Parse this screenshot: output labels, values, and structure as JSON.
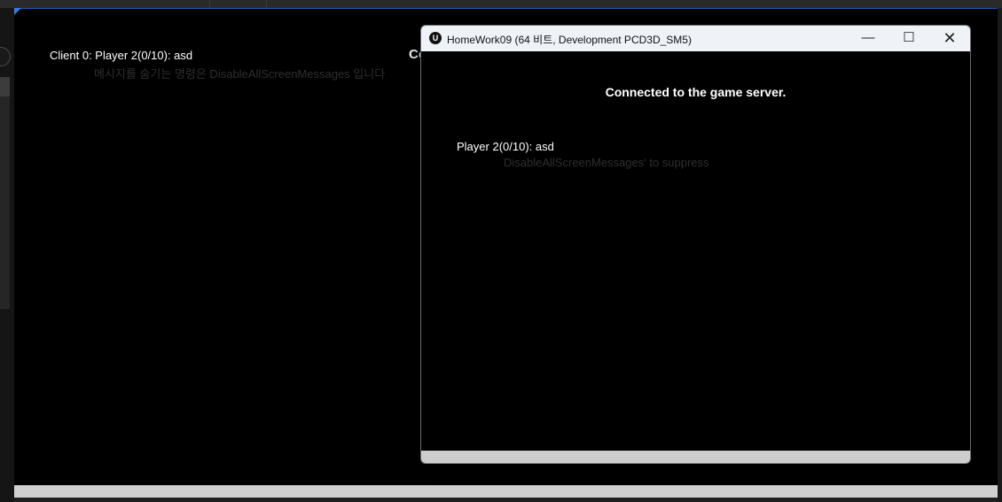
{
  "viewport": {
    "client_message": "Client 0: Player 2(0/10): asd",
    "ghost_message": "메시지를 숨기는 명령은 DisableAllScreenMessages 입니다",
    "partial_text": "Co"
  },
  "game_window": {
    "title": "HomeWork09 (64 비트, Development PCD3D_SM5)",
    "logo": "U",
    "minimize_glyph": "—",
    "maximize_glyph": "☐",
    "close_glyph": "✕",
    "connected_message": "Connected to the game server.",
    "player_message": "Player 2(0/10): asd",
    "ghost_message": "DisableAllScreenMessages' to suppress"
  }
}
